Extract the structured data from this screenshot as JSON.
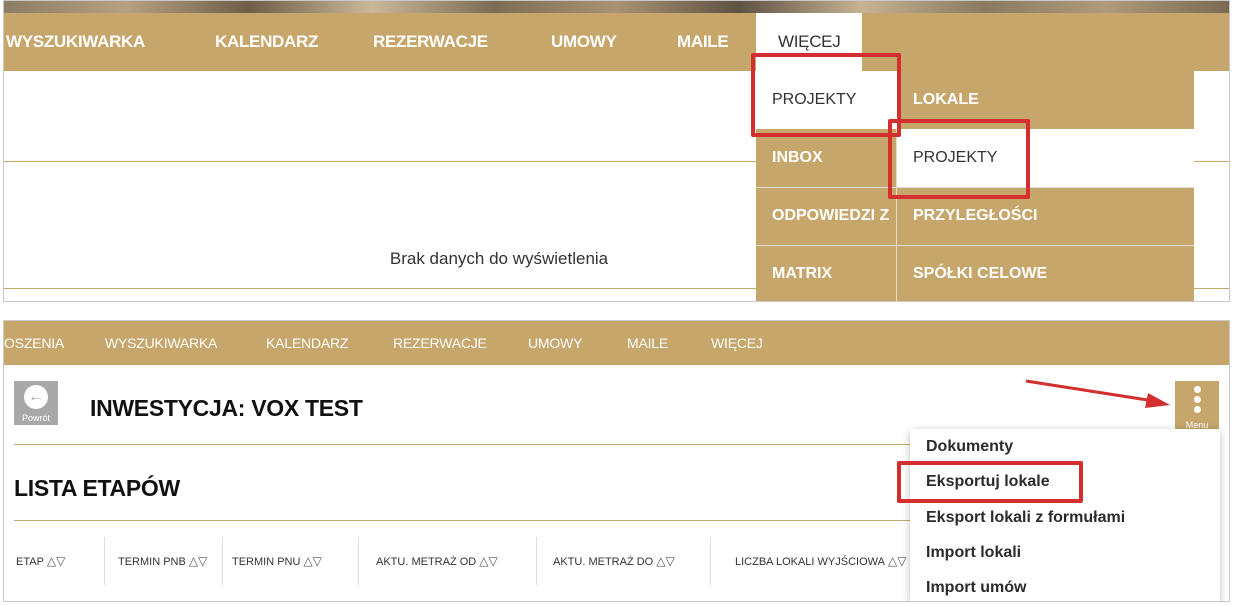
{
  "top": {
    "nav": [
      "WYSZUKIWARKA",
      "KALENDARZ",
      "REZERWACJE",
      "UMOWY",
      "MAILE",
      "WIĘCEJ"
    ],
    "empty_message": "Brak danych do wyświetlenia",
    "dropdown": {
      "left": [
        "PROJEKTY",
        "INBOX",
        "ODPOWIEDZI Z",
        "MATRIX"
      ],
      "right": [
        "LOKALE",
        "PROJEKTY",
        "PRZYLEGŁOŚCI",
        "SPÓŁKI CELOWE"
      ]
    }
  },
  "bottom": {
    "nav": [
      "OSZENIA",
      "WYSZUKIWARKA",
      "KALENDARZ",
      "REZERWACJE",
      "UMOWY",
      "MAILE",
      "WIĘCEJ"
    ],
    "back_label": "Powrót",
    "title": "INWESTYCJA: VOX TEST",
    "list_title": "LISTA ETAPÓW",
    "menu_label": "Menu",
    "menu_items": [
      "Dokumenty",
      "Eksportuj lokale",
      "Eksport lokali z formułami",
      "Import lokali",
      "Import umów"
    ],
    "columns": [
      "ETAP",
      "TERMIN PNB",
      "TERMIN PNU",
      "AKTU. METRAŻ OD",
      "AKTU. METRAŻ DO",
      "LICZBA LOKALI WYJŚCIOWA"
    ],
    "sort_glyphs": "△▽"
  },
  "colors": {
    "accent": "#c6a66b",
    "highlight": "#d32f2f",
    "back_button": "#a8a8a8"
  }
}
